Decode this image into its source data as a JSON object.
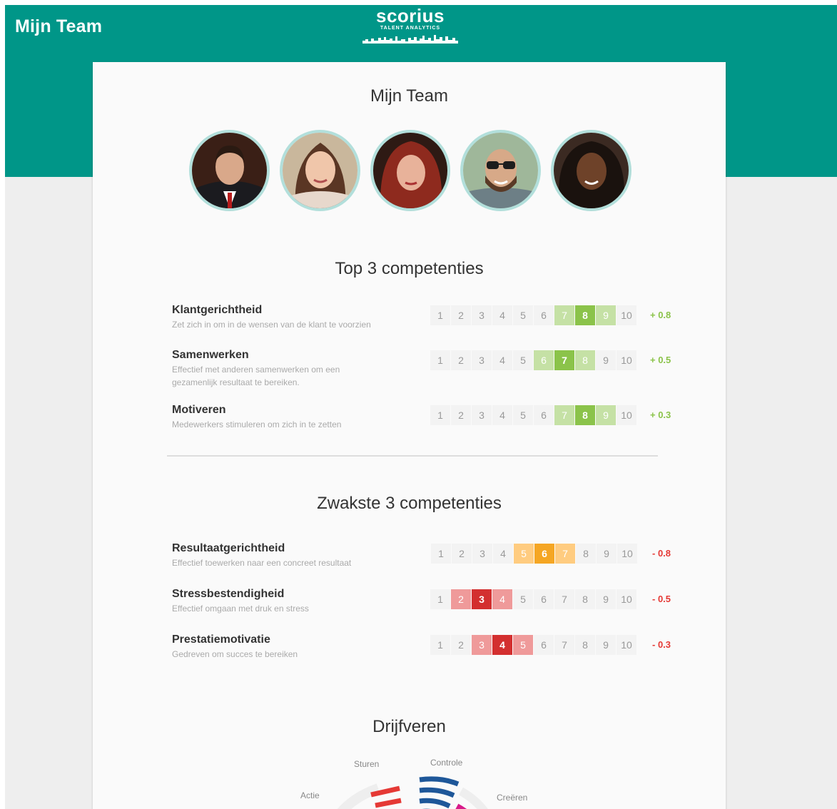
{
  "app": {
    "title": "Mijn Team"
  },
  "logo": {
    "word": "scorius",
    "subtitle": "TALENT ANALYTICS"
  },
  "page": {
    "title": "Mijn Team"
  },
  "colors": {
    "header": "#009688",
    "green_light": "#c5e1a5",
    "green_mid": "#aed581",
    "green_dark": "#8bc34a",
    "orange_light": "#ffcc80",
    "orange_dark": "#f5a623",
    "red_light": "#ef9a9a",
    "red_mid": "#e57373",
    "red_dark": "#d32f2f",
    "positive": "#8bc34a",
    "negative": "#e53935"
  },
  "team_members": [
    {
      "avatar_icon": "person-avatar-1"
    },
    {
      "avatar_icon": "person-avatar-2"
    },
    {
      "avatar_icon": "person-avatar-3"
    },
    {
      "avatar_icon": "person-avatar-4"
    },
    {
      "avatar_icon": "person-avatar-5"
    }
  ],
  "top": {
    "title": "Top 3 competenties",
    "items": [
      {
        "name": "Klantgerichtheid",
        "description": "Zet zich in om in de wensen van de klant te voorzien",
        "score": 8,
        "delta": "+ 0.8",
        "scale": [
          "1",
          "2",
          "3",
          "4",
          "5",
          "6",
          "7",
          "8",
          "9",
          "10"
        ]
      },
      {
        "name": "Samenwerken",
        "description": "Effectief met anderen samenwerken om een gezamenlijk resultaat te bereiken.",
        "score": 7,
        "delta": "+ 0.5",
        "scale": [
          "1",
          "2",
          "3",
          "4",
          "5",
          "6",
          "7",
          "8",
          "9",
          "10"
        ]
      },
      {
        "name": "Motiveren",
        "description": "Medewerkers stimuleren om zich in te zetten",
        "score": 8,
        "delta": "+ 0.3",
        "scale": [
          "1",
          "2",
          "3",
          "4",
          "5",
          "6",
          "7",
          "8",
          "9",
          "10"
        ]
      }
    ]
  },
  "weak": {
    "title": "Zwakste 3 competenties",
    "items": [
      {
        "name": "Resultaatgerichtheid",
        "description": "Effectief toewerken naar een concreet resultaat",
        "score": 6,
        "delta": "- 0.8",
        "tone": "orange",
        "scale": [
          "1",
          "2",
          "3",
          "4",
          "5",
          "6",
          "7",
          "8",
          "9",
          "10"
        ]
      },
      {
        "name": "Stressbestendigheid",
        "description": "Effectief omgaan met druk en stress",
        "score": 3,
        "delta": "- 0.5",
        "tone": "red",
        "scale": [
          "1",
          "2",
          "3",
          "4",
          "5",
          "6",
          "7",
          "8",
          "9",
          "10"
        ]
      },
      {
        "name": "Prestatiemotivatie",
        "description": "Gedreven om succes te bereiken",
        "score": 4,
        "delta": "- 0.3",
        "tone": "red",
        "scale": [
          "1",
          "2",
          "3",
          "4",
          "5",
          "6",
          "7",
          "8",
          "9",
          "10"
        ]
      }
    ]
  },
  "drivers": {
    "title": "Drijfveren",
    "labels": {
      "sturen": "Sturen",
      "controle": "Controle",
      "actie": "Actie",
      "creeren": "Creëren"
    }
  }
}
